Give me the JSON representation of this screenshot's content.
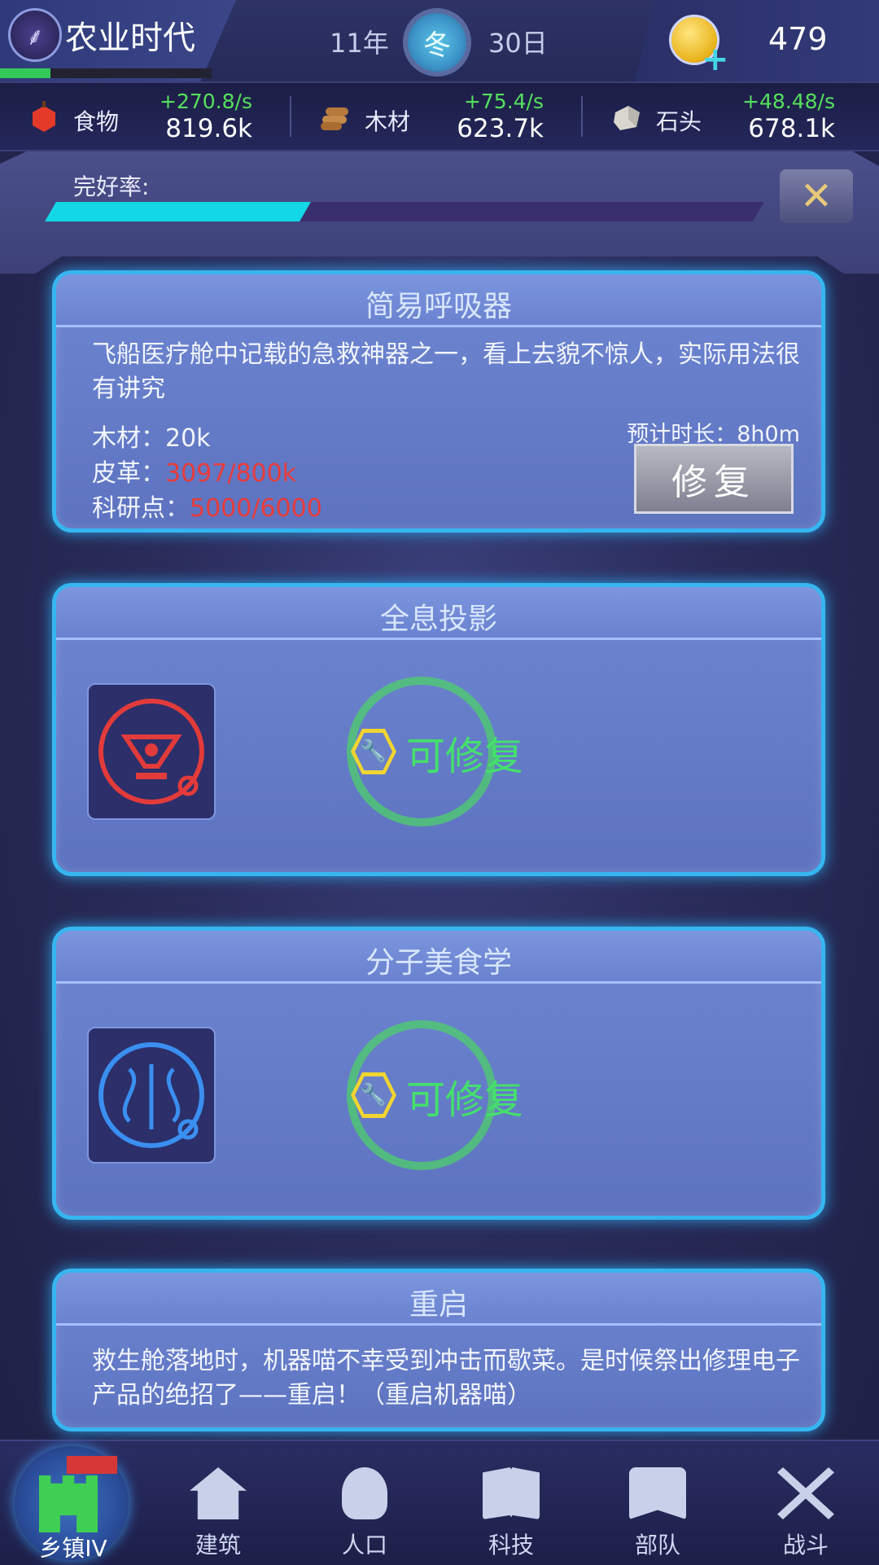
{
  "header": {
    "era_title": "农业时代",
    "era_progress": 0.24,
    "year": "11年",
    "season": "冬",
    "day": "30日",
    "coins": "479"
  },
  "resources": [
    {
      "name": "食物",
      "rate": "+270.8/s",
      "amount": "819.6k",
      "icon": "apple-icon"
    },
    {
      "name": "木材",
      "rate": "+75.4/s",
      "amount": "623.7k",
      "icon": "logs-icon"
    },
    {
      "name": "石头",
      "rate": "+48.48/s",
      "amount": "678.1k",
      "icon": "stone-icon"
    }
  ],
  "durability": {
    "label": "完好率:",
    "value": 0.36
  },
  "cards": [
    {
      "title": "简易呼吸器",
      "description": "飞船医疗舱中记载的急救神器之一，看上去貌不惊人，实际用法很有讲究",
      "req_wood_label": "木材：",
      "req_wood_value": "20k",
      "req_leather_label": "皮革：",
      "req_leather_value": "3097/800k",
      "req_research_label": "科研点：",
      "req_research_value": "5000/6000",
      "eta_label": "预计时长：8h0m",
      "button": "修复"
    },
    {
      "title": "全息投影",
      "status": "可修复",
      "icon": "hologram-paw-icon"
    },
    {
      "title": "分子美食学",
      "status": "可修复",
      "icon": "dna-wheat-icon"
    },
    {
      "title": "重启",
      "description": "救生舱落地时，机器喵不幸受到冲击而歇菜。是时候祭出修理电子产品的绝招了——重启！（重启机器喵）"
    }
  ],
  "nav": {
    "home": "乡镇IV",
    "items": [
      "建筑",
      "人口",
      "科技",
      "部队",
      "战斗"
    ]
  },
  "colors": {
    "accent_cyan": "#13d6e6",
    "green_status": "#44e06c",
    "red_shortage": "#e83b3b",
    "card_border": "#36b6f0"
  }
}
